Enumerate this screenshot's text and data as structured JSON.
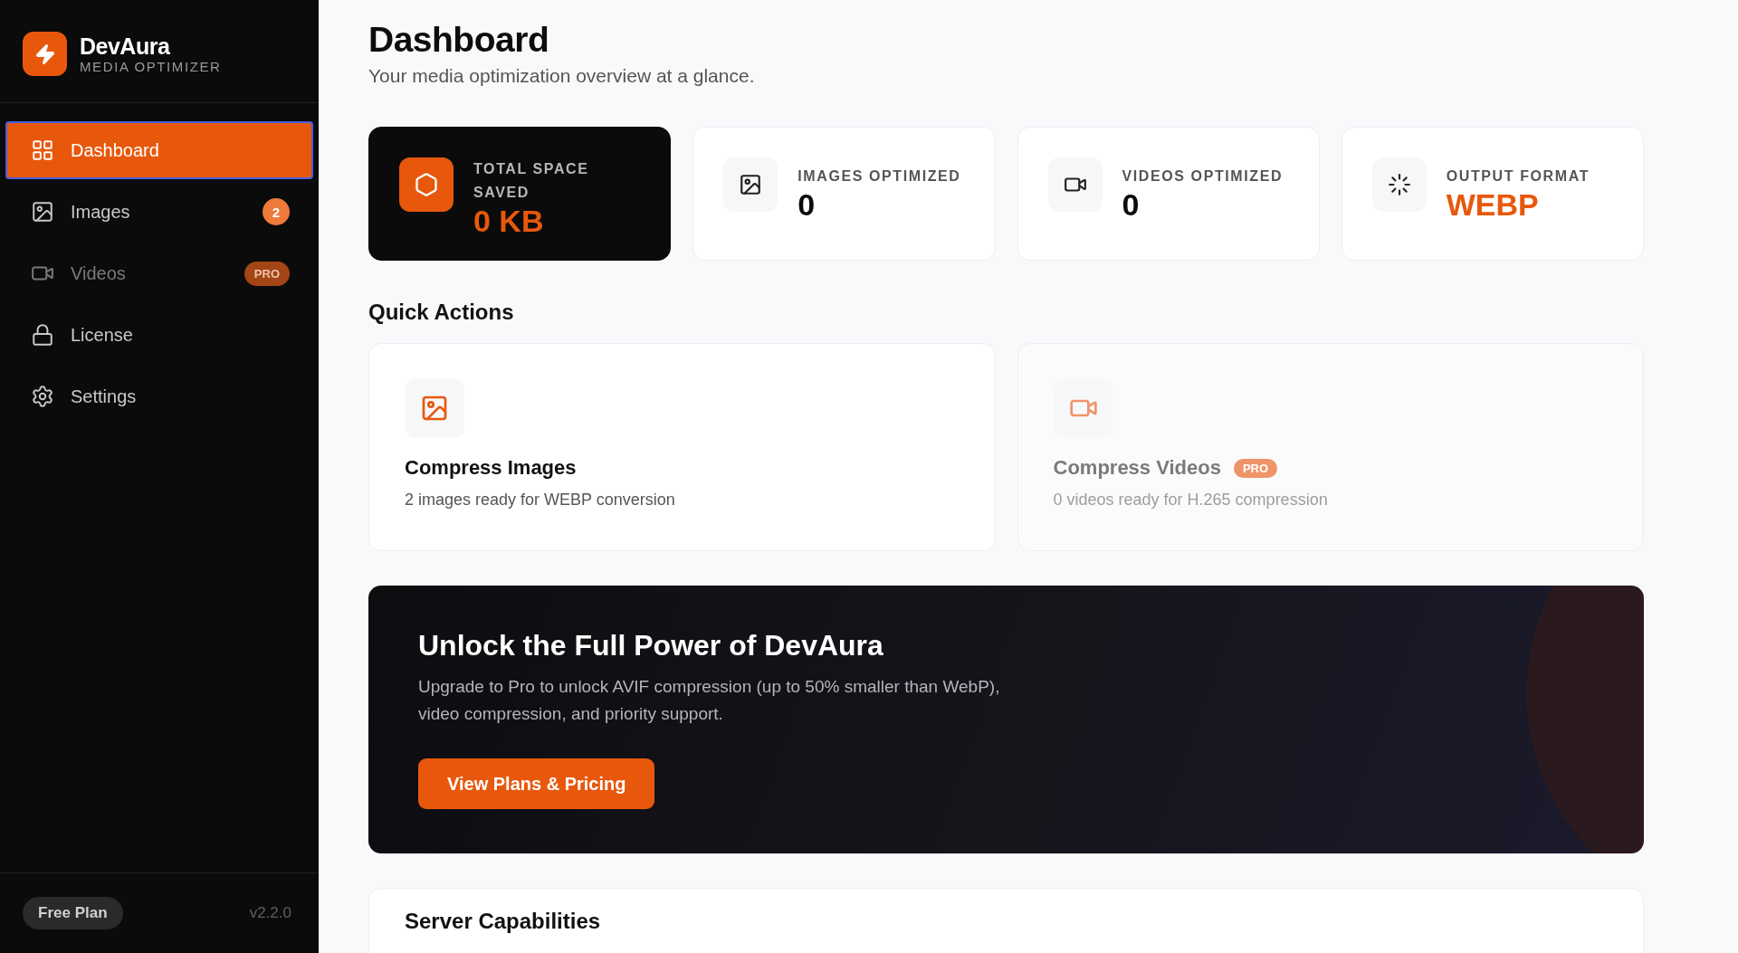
{
  "brand": {
    "name": "DevAura",
    "tagline": "MEDIA OPTIMIZER"
  },
  "nav": [
    {
      "label": "Dashboard",
      "selected": true,
      "disabled": false
    },
    {
      "label": "Images",
      "selected": false,
      "disabled": false,
      "badge": {
        "text": "2",
        "kind": "count"
      }
    },
    {
      "label": "Videos",
      "selected": false,
      "disabled": true,
      "badge": {
        "text": "PRO",
        "kind": "pro"
      }
    },
    {
      "label": "License",
      "selected": false,
      "disabled": false
    },
    {
      "label": "Settings",
      "selected": false,
      "disabled": false
    }
  ],
  "sidebar_footer": {
    "plan": "Free Plan",
    "version": "v2.2.0"
  },
  "header": {
    "title": "Dashboard",
    "subtitle": "Your media optimization overview at a glance."
  },
  "stats": [
    {
      "label": "TOTAL SPACE SAVED",
      "value": "0 KB",
      "kind": "featured",
      "accent": true
    },
    {
      "label": "IMAGES OPTIMIZED",
      "value": "0",
      "kind": "plain",
      "accent": false
    },
    {
      "label": "VIDEOS OPTIMIZED",
      "value": "0",
      "kind": "plain",
      "accent": false
    },
    {
      "label": "OUTPUT FORMAT",
      "value": "WEBP",
      "kind": "plain",
      "accent": true
    }
  ],
  "quick_actions": {
    "title": "Quick Actions",
    "items": [
      {
        "title": "Compress Images",
        "description": "2 images ready for WEBP conversion",
        "disabled": false
      },
      {
        "title": "Compress Videos",
        "description": "0 videos ready for H.265 compression",
        "disabled": true,
        "badge": "PRO"
      }
    ]
  },
  "promo": {
    "title": "Unlock the Full Power of DevAura",
    "text": "Upgrade to Pro to unlock AVIF compression (up to 50% smaller than WebP), video compression, and priority support.",
    "button": "View Plans & Pricing"
  },
  "capabilities": {
    "title": "Server Capabilities"
  }
}
